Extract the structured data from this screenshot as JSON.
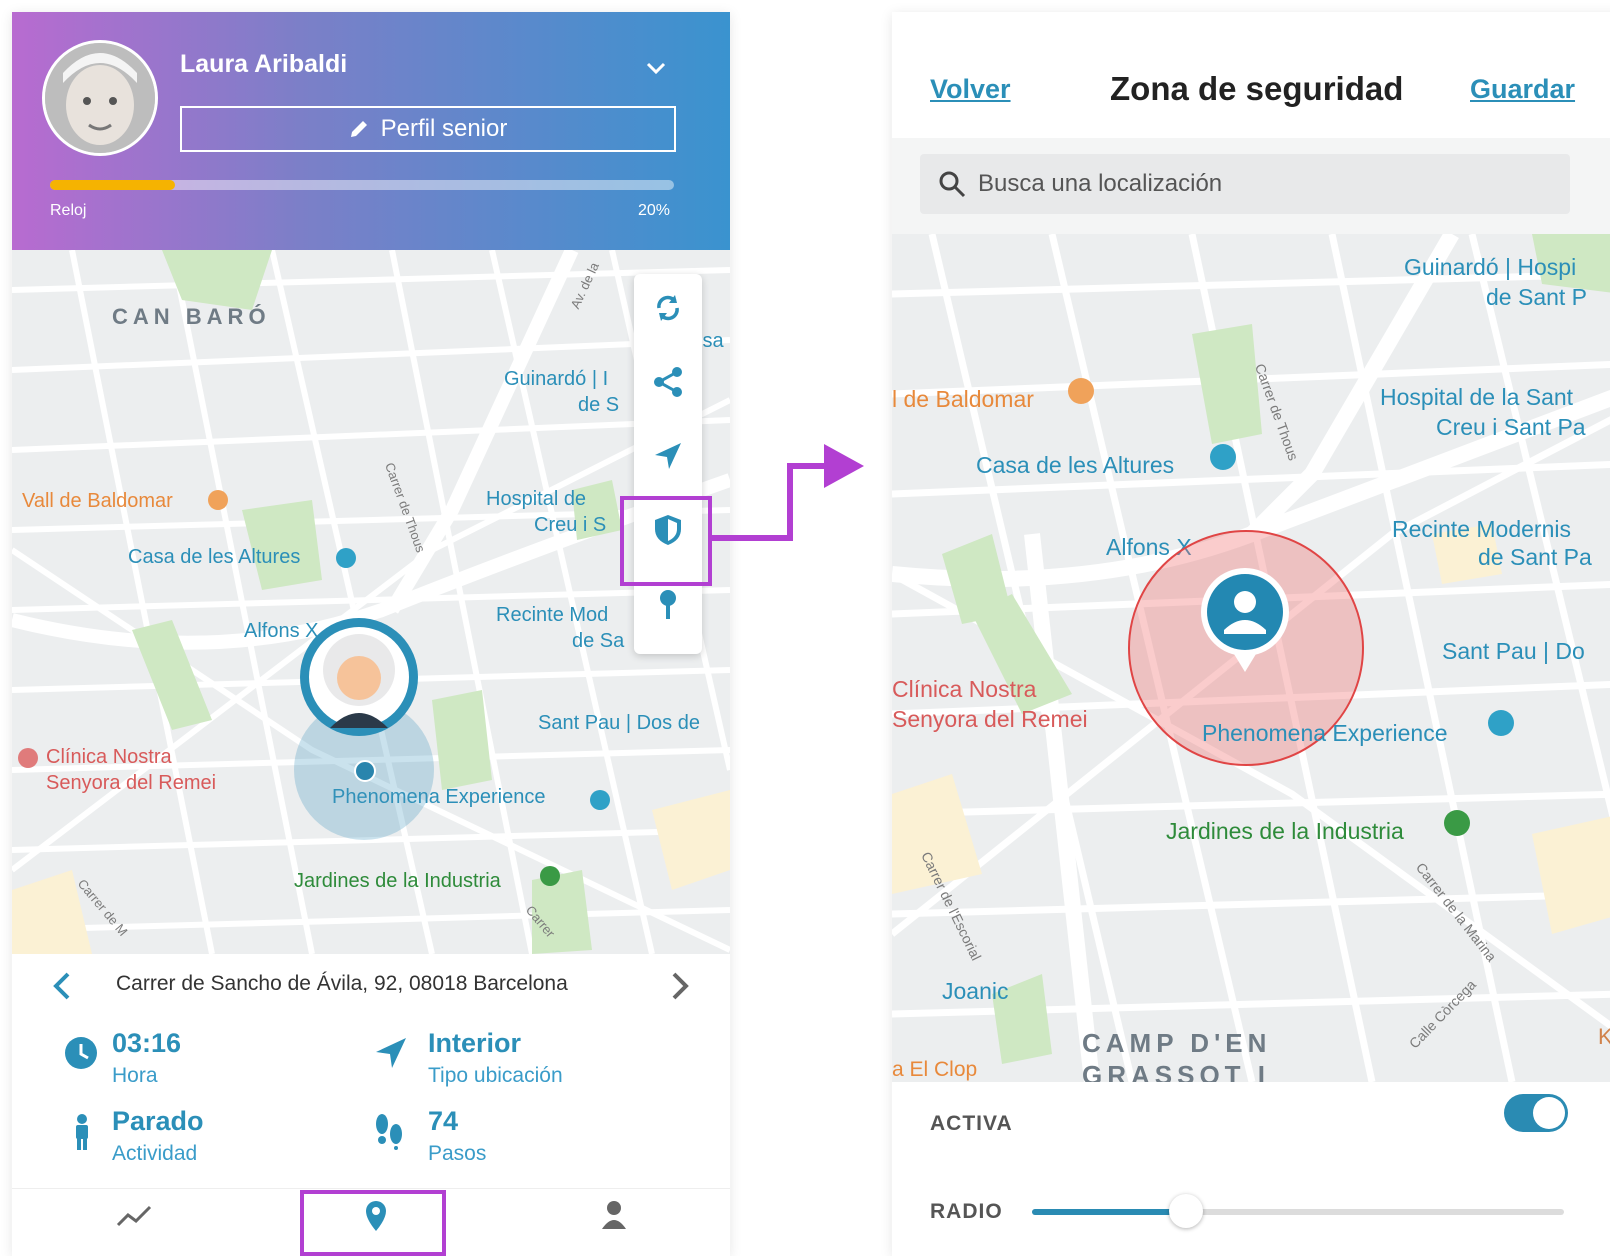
{
  "left_screen": {
    "profile": {
      "name": "Laura Aribaldi",
      "edit_button": "Perfil senior",
      "progress_label": "Reloj",
      "progress_value_text": "20%",
      "progress_fraction": 0.2
    },
    "map_labels": {
      "district": "CAN BARÓ",
      "street_av": "Av. de la",
      "guinardo": "Guinardó | I",
      "guinardo_b": "de S",
      "isa": "isa",
      "vall": "Vall de Baldomar",
      "casa": "Casa de les Altures",
      "hospital_a": "Hospital de",
      "hospital_b": "Creu i S",
      "alfons": "Alfons X",
      "recinte_a": "Recinte Mod",
      "recinte_b": "de Sa",
      "santpau": "Sant Pau | Dos de",
      "clinica_a": "Clínica Nostra",
      "clinica_b": "Senyora del Remei",
      "phenomena": "Phenomena Experience",
      "jardines": "Jardines de la Industria",
      "thous": "Carrer de Thous",
      "carrer_bl": "Carrer de M",
      "carrer_br": "Carrer"
    },
    "fab_icons": [
      "refresh-icon",
      "share-icon",
      "navigation-icon",
      "shield-icon",
      "pin-icon"
    ],
    "address": "Carrer de Sancho de Ávila, 92, 08018 Barcelona",
    "info": {
      "time_value": "03:16",
      "time_label": "Hora",
      "location_value": "Interior",
      "location_label": "Tipo ubicación",
      "activity_value": "Parado",
      "activity_label": "Actividad",
      "steps_value": "74",
      "steps_label": "Pasos"
    },
    "bottom_nav_icons": [
      "activity-icon",
      "location-icon",
      "person-icon"
    ]
  },
  "right_screen": {
    "back_link": "Volver",
    "title": "Zona de seguridad",
    "save_link": "Guardar",
    "search_placeholder": "Busca una localización",
    "map_labels": {
      "guinardo_a": "Guinardó | Hospi",
      "guinardo_b": "de Sant P",
      "baldomar": "l de Baldomar",
      "hospital_a": "Hospital de la Sant",
      "hospital_b": "Creu i Sant Pa",
      "casa": "Casa de les Altures",
      "recinte_a": "Recinte Modernis",
      "recinte_b": "de Sant Pa",
      "alfons": "Alfons X",
      "santpau": "Sant Pau | Do",
      "clinica_a": "Clínica Nostra",
      "clinica_b": "Senyora del Remei",
      "phenomena": "Phenomena Experience",
      "jardines": "Jardines de la Industria",
      "joanic": "Joanic",
      "district": "CAMP D'EN",
      "district_b": "GRASSOT I",
      "elclot": "a El Clop",
      "escorial": "Carrer de l'Escorial",
      "marina": "Carrer de la Marina",
      "corcega": "Calle Còrcega",
      "thous": "Carrer de Thous",
      "k": "K"
    },
    "active_label": "ACTIVA",
    "active_on": true,
    "radius_label": "RADIO",
    "radius_fraction": 0.29
  },
  "colors": {
    "accent": "#2b8fb8",
    "highlight": "#b23fd2",
    "progress": "#f5b301",
    "zone": "#e04545"
  }
}
